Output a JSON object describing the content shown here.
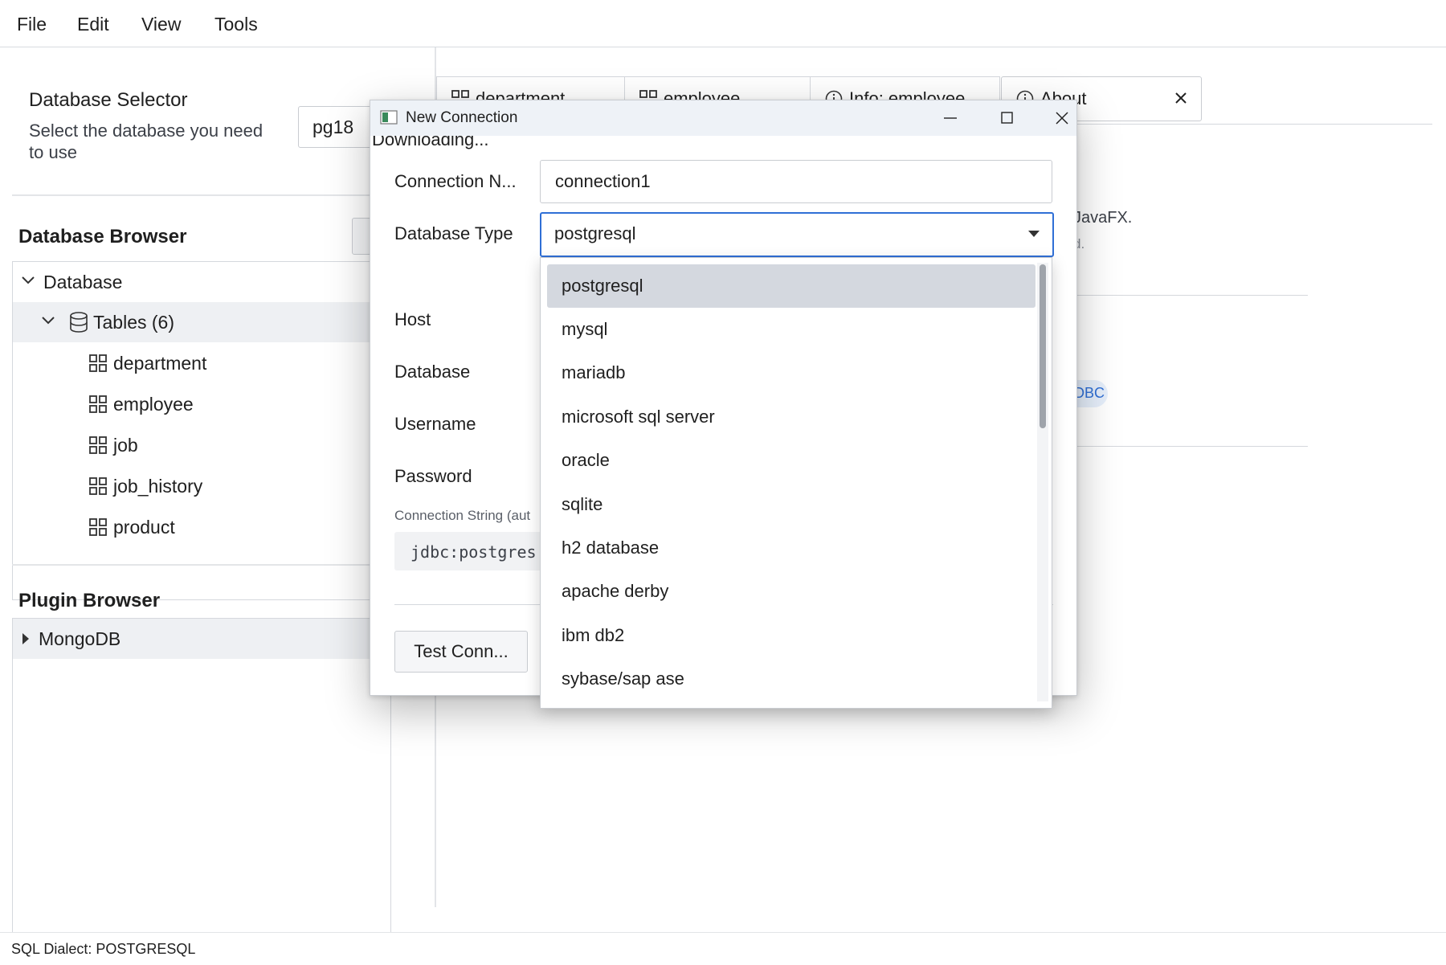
{
  "menubar": {
    "items": [
      "File",
      "Edit",
      "View",
      "Tools"
    ]
  },
  "db_selector": {
    "title": "Database Selector",
    "subtitle_line1": "Select the database you need",
    "subtitle_line2": "to use",
    "value": "pg18"
  },
  "db_browser": {
    "title": "Database Browser",
    "root": "Database",
    "group": "Tables (6)",
    "tables": [
      "department",
      "employee",
      "job",
      "job_history",
      "product"
    ]
  },
  "plugin_browser": {
    "title": "Plugin Browser",
    "items": [
      "MongoDB"
    ]
  },
  "tabs": [
    {
      "label": "department",
      "icon": "grid-icon"
    },
    {
      "label": "employee",
      "icon": "grid-icon"
    },
    {
      "label": "Info: employee",
      "icon": "info-icon"
    },
    {
      "label": "About",
      "icon": "info-icon"
    }
  ],
  "about_fragments": {
    "line1": "JavaFX.",
    "line2": "d.",
    "badge": "DBC"
  },
  "dialog": {
    "title": "New Connection",
    "downloading": "Downloading...",
    "connection_name_label": "Connection N...",
    "connection_name_value": "connection1",
    "db_type_label": "Database Type",
    "db_type_value": "postgresql",
    "host_label": "Host",
    "database_label": "Database",
    "username_label": "Username",
    "password_label": "Password",
    "conn_string_label": "Connection String (aut",
    "conn_string_value": "jdbc:postgres",
    "test_button": "Test Conn..."
  },
  "dropdown": {
    "options": [
      "postgresql",
      "mysql",
      "mariadb",
      "microsoft sql server",
      "oracle",
      "sqlite",
      "h2 database",
      "apache derby",
      "ibm db2",
      "sybase/sap ase"
    ],
    "selected": "postgresql"
  },
  "status": {
    "text": "SQL Dialect: POSTGRESQL"
  },
  "colors": {
    "accent": "#2f6fd6",
    "selection": "#d4d8df",
    "titlebar": "#eef2f7"
  }
}
